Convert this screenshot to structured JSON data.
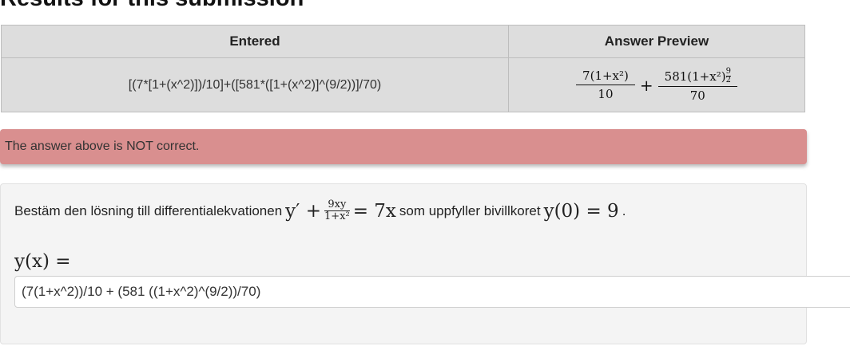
{
  "heading": "Results for this submission",
  "results": {
    "col_entered": "Entered",
    "col_preview": "Answer Preview",
    "entered": "[(7*[1+(x^2)])/10]+([581*([1+(x^2)]^(9/2))]/70)",
    "preview": {
      "frac1_num": "7(1+x²)",
      "frac1_den": "10",
      "plus": "+",
      "frac2_num": "581(1+x²)",
      "frac2_exp_num": "9",
      "frac2_exp_den": "2",
      "frac2_den": "70"
    }
  },
  "alert": {
    "text": "The answer above is NOT correct.",
    "color": "#d98f8f"
  },
  "problem": {
    "text_before": "Bestäm den lösning till differentialekvationen",
    "eq_left": "y′ +",
    "eq_frac_num": "9xy",
    "eq_frac_den": "1+x²",
    "eq_right": "= 7x",
    "text_middle": "som uppfyller bivillkoret",
    "condition": "y(0) = 9",
    "text_after": ".",
    "answer_label": "y(x) =",
    "answer_value": "(7(1+x^2))/10 + (581 ((1+x^2)^(9/2))/70)"
  }
}
